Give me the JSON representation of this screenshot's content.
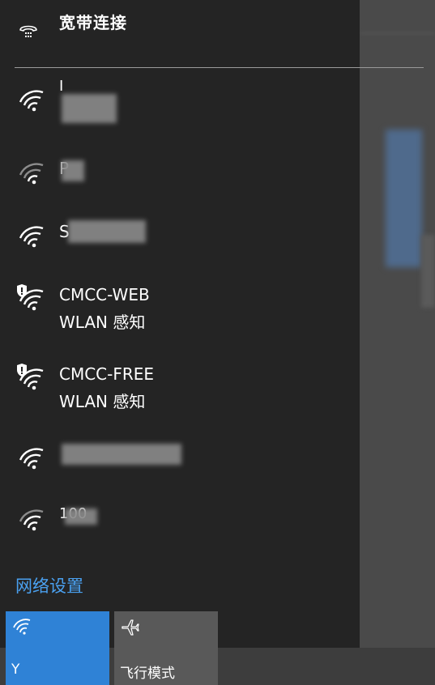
{
  "header": {
    "title": "宽带连接",
    "icon": "dial-up-phone-icon"
  },
  "networks": [
    {
      "name": "I",
      "status": "",
      "secured_warning": false,
      "obscured": true
    },
    {
      "name": "P",
      "status": "",
      "secured_warning": false,
      "obscured": true
    },
    {
      "name": "S",
      "status": "",
      "secured_warning": false,
      "obscured": true
    },
    {
      "name": "CMCC-WEB",
      "status": "WLAN 感知",
      "secured_warning": true,
      "obscured": false
    },
    {
      "name": "CMCC-FREE",
      "status": "WLAN 感知",
      "secured_warning": true,
      "obscured": false
    },
    {
      "name": "",
      "status": "",
      "secured_warning": false,
      "obscured": true
    },
    {
      "name": "100",
      "status": "",
      "secured_warning": false,
      "obscured": true
    }
  ],
  "settings_link": "网络设置",
  "quick_actions": [
    {
      "label": "Y",
      "icon": "wifi-icon",
      "active": true,
      "color": "#2f82d6"
    },
    {
      "label": "飞行模式",
      "icon": "airplane-icon",
      "active": false,
      "color": "#595959"
    }
  ],
  "colors": {
    "panel": "#242424",
    "accent": "#2f82d6",
    "link": "#4aa0ef"
  }
}
